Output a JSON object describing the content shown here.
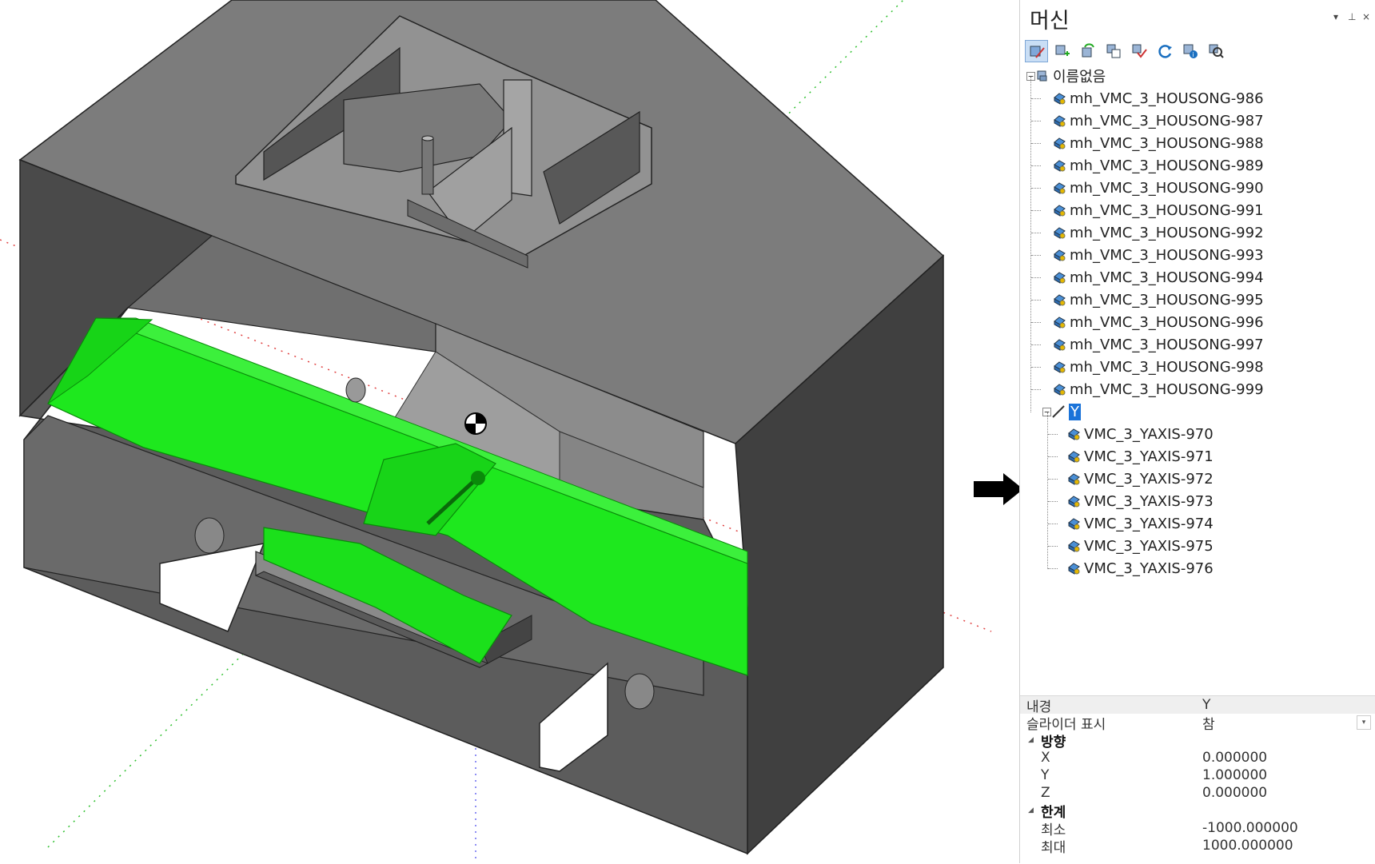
{
  "panel": {
    "title": "머신",
    "pin_glyph": "▾ ⊣ ×"
  },
  "toolbar": {
    "buttons": [
      "edit-machine-icon",
      "add-component-icon",
      "replace-icon",
      "copy-icon",
      "paste-icon",
      "refresh-icon",
      "info-icon",
      "search-icon"
    ]
  },
  "tree": {
    "root": "이름없음",
    "housings": [
      "mh_VMC_3_HOUSONG-986",
      "mh_VMC_3_HOUSONG-987",
      "mh_VMC_3_HOUSONG-988",
      "mh_VMC_3_HOUSONG-989",
      "mh_VMC_3_HOUSONG-990",
      "mh_VMC_3_HOUSONG-991",
      "mh_VMC_3_HOUSONG-992",
      "mh_VMC_3_HOUSONG-993",
      "mh_VMC_3_HOUSONG-994",
      "mh_VMC_3_HOUSONG-995",
      "mh_VMC_3_HOUSONG-996",
      "mh_VMC_3_HOUSONG-997",
      "mh_VMC_3_HOUSONG-998",
      "mh_VMC_3_HOUSONG-999"
    ],
    "axis_node": "Y",
    "axis_children": [
      "VMC_3_YAXIS-970",
      "VMC_3_YAXIS-971",
      "VMC_3_YAXIS-972",
      "VMC_3_YAXIS-973",
      "VMC_3_YAXIS-974",
      "VMC_3_YAXIS-975",
      "VMC_3_YAXIS-976"
    ]
  },
  "properties": {
    "name_label": "내경",
    "name_value": "Y",
    "slider_label": "슬라이더 표시",
    "slider_value": "참",
    "direction_label": "방향",
    "x_label": "X",
    "x_value": "0.000000",
    "y_label": "Y",
    "y_value": "1.000000",
    "z_label": "Z",
    "z_value": "0.000000",
    "limit_label": "한계",
    "min_label": "최소",
    "min_value": "-1000.000000",
    "max_label": "최대",
    "max_value": "1000.000000"
  },
  "colors": {
    "green": "#1ee81e",
    "housing_dark": "#555555",
    "housing_mid": "#7a7a7a",
    "housing_light": "#9a9a9a",
    "selection": "#1a73d9"
  }
}
